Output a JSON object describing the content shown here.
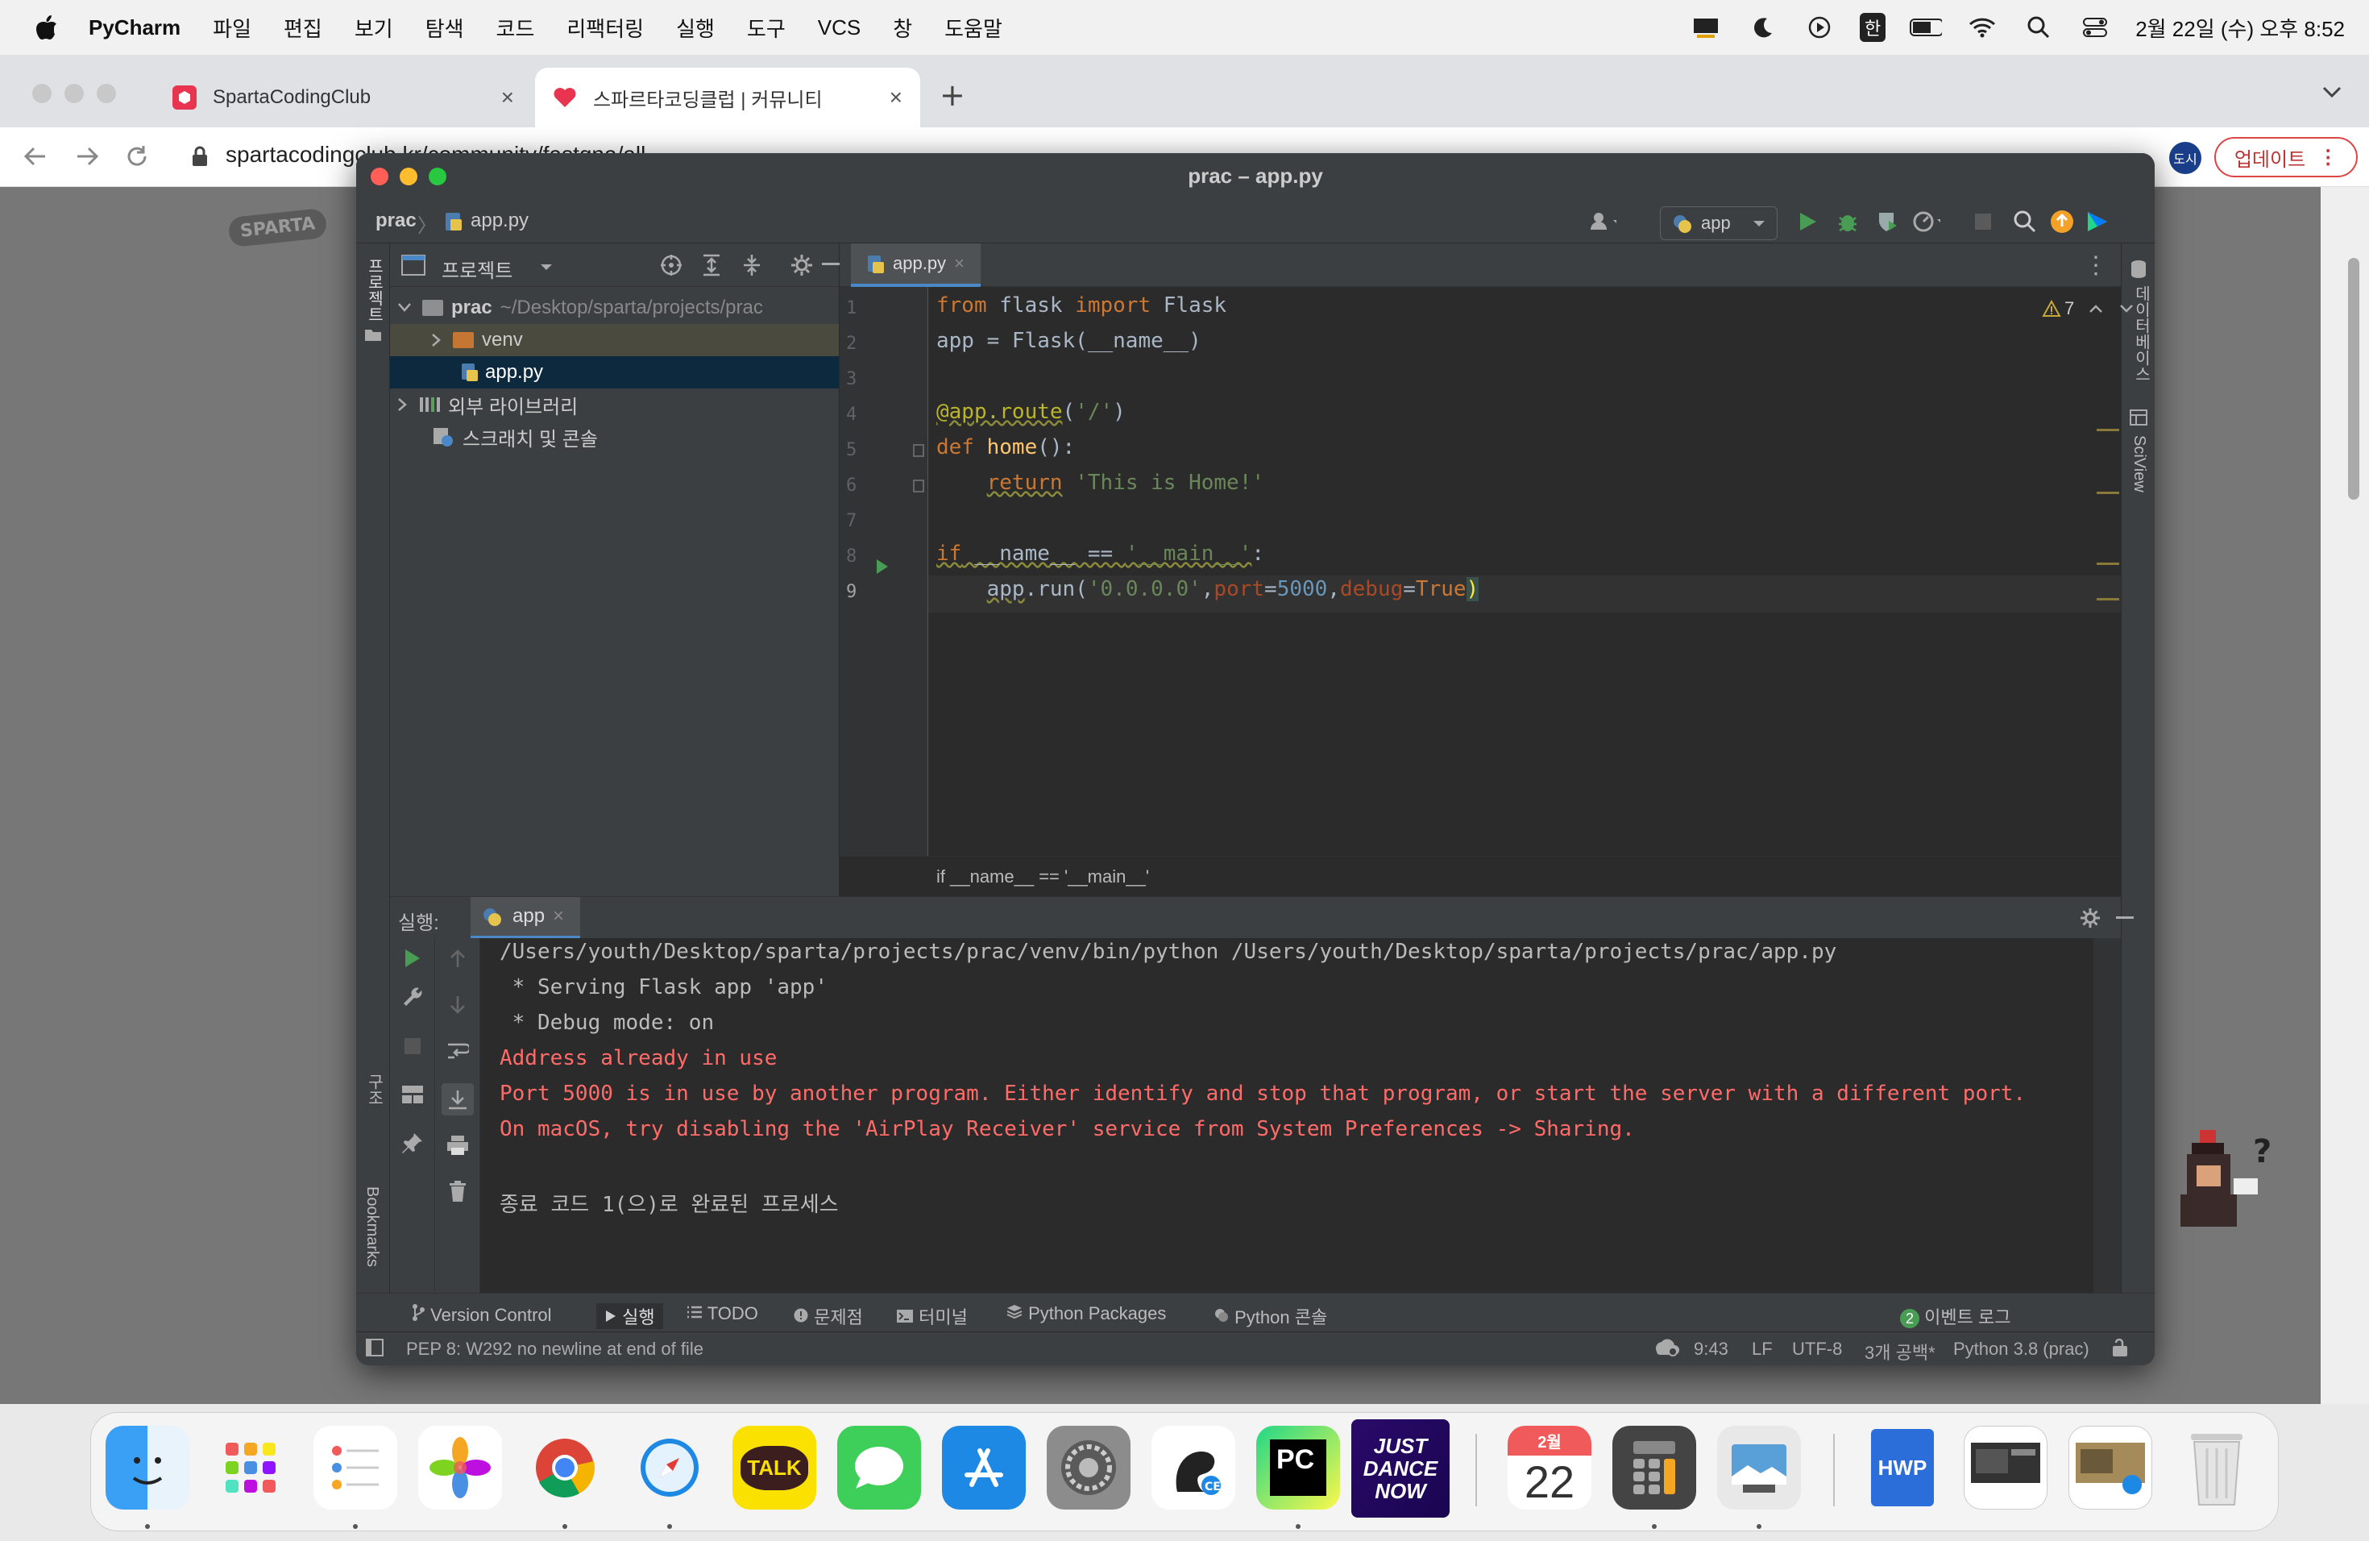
{
  "menubar": {
    "app_name": "PyCharm",
    "items": [
      "파일",
      "편집",
      "보기",
      "탐색",
      "코드",
      "리팩터링",
      "실행",
      "도구",
      "VCS",
      "창",
      "도움말"
    ],
    "ime": "한",
    "clock": "2월 22일 (수) 오후 8:52"
  },
  "browser": {
    "tabs": [
      {
        "title": "SpartaCodingClub",
        "active": false
      },
      {
        "title": "스파르타코딩클럽 | 커뮤니티",
        "active": true
      }
    ],
    "url": "spartacodingclub.kr/community/fastqna/all",
    "profile": "도시",
    "update_label": "업데이트",
    "site_logo": "SPARTA"
  },
  "pycharm": {
    "window_title": "prac – app.py",
    "breadcrumb": {
      "project": "prac",
      "file": "app.py"
    },
    "run_config": "app",
    "left_stripe": {
      "project": "프로젝트",
      "structure": "구조",
      "bookmarks": "Bookmarks"
    },
    "right_stripe": {
      "database": "데이터베이스",
      "sciview": "SciView"
    },
    "project_panel": {
      "title": "프로젝트",
      "tree": [
        {
          "label": "prac",
          "path": "~/Desktop/sparta/projects/prac"
        },
        {
          "label": "venv"
        },
        {
          "label": "app.py"
        },
        {
          "label": "외부 라이브러리"
        },
        {
          "label": "스크래치 및 콘솔"
        }
      ]
    },
    "editor": {
      "tab": "app.py",
      "warnings": "7",
      "line_numbers": [
        "1",
        "2",
        "3",
        "4",
        "5",
        "6",
        "7",
        "8",
        "9"
      ],
      "crumb": "if __name__ == '__main__'"
    },
    "run_panel": {
      "label": "실행:",
      "tab": "app",
      "console": [
        {
          "text": "/Users/youth/Desktop/sparta/projects/prac/venv/bin/python /Users/youth/Desktop/sparta/projects/prac/app.py",
          "kind": "normal"
        },
        {
          "text": " * Serving Flask app 'app'",
          "kind": "normal"
        },
        {
          "text": " * Debug mode: on",
          "kind": "normal"
        },
        {
          "text": "Address already in use",
          "kind": "err"
        },
        {
          "text": "Port 5000 is in use by another program. Either identify and stop that program, or start the server with a different port.",
          "kind": "err"
        },
        {
          "text": "On macOS, try disabling the 'AirPlay Receiver' service from System Preferences -> Sharing.",
          "kind": "err"
        },
        {
          "text": "",
          "kind": "normal"
        },
        {
          "text": "종료 코드 1(으)로 완료된 프로세스",
          "kind": "normal"
        }
      ]
    },
    "tool_tabs": [
      "Version Control",
      "실행",
      "TODO",
      "문제점",
      "터미널",
      "Python Packages",
      "Python 콘솔"
    ],
    "event_log": {
      "count": "2",
      "label": "이벤트 로그"
    },
    "status": {
      "message": "PEP 8: W292 no newline at end of file",
      "position": "9:43",
      "line_sep": "LF",
      "encoding": "UTF-8",
      "indent": "3개 공백*",
      "interpreter": "Python 3.8 (prac)"
    }
  },
  "dock": {
    "calendar_month": "2월",
    "calendar_day": "22",
    "kakao_label": "TALK",
    "pycharm_label": "PC",
    "justdance_label": "JUST DANCE NOW",
    "hwp_label": "HWP"
  }
}
